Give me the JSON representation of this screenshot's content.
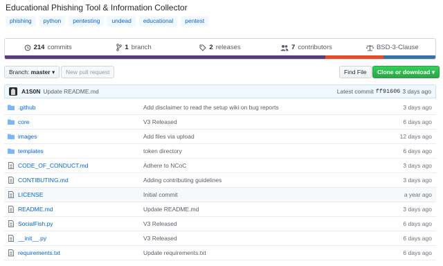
{
  "repo": {
    "description": "Educational Phishing Tool & Information Collector",
    "topics": [
      "phishing",
      "python",
      "pentesting",
      "undead",
      "educational",
      "pentest"
    ]
  },
  "summary": {
    "commits_count": "214",
    "commits_label": "commits",
    "branches_count": "1",
    "branches_label": "branch",
    "releases_count": "2",
    "releases_label": "releases",
    "contributors_count": "7",
    "contributors_label": "contributors",
    "license": "BSD-3-Clause"
  },
  "language_bar": [
    {
      "color": "#563d7c",
      "share": 0.745
    },
    {
      "color": "#e34c26",
      "share": 0.135
    },
    {
      "color": "#3572a5",
      "share": 0.12
    }
  ],
  "toolbar": {
    "branch_label": "Branch:",
    "branch_value": "master",
    "new_pr_label": "New pull request",
    "find_file_label": "Find File",
    "clone_label": "Clone or download"
  },
  "commit": {
    "author": "A1S0N",
    "message": "Update README.md",
    "latest_label": "Latest commit",
    "sha": "ff91606",
    "age": "3 days ago"
  },
  "files": [
    {
      "type": "dir",
      "name": ".github",
      "message": "Add disclaimer to read the setup wiki on bug reports",
      "age": "3 days ago"
    },
    {
      "type": "dir",
      "name": "core",
      "message": "V3 Released",
      "age": "6 days ago"
    },
    {
      "type": "dir",
      "name": "images",
      "message": "Add files via upload",
      "age": "12 days ago"
    },
    {
      "type": "dir",
      "name": "templates",
      "message": "token directory",
      "age": "6 days ago"
    },
    {
      "type": "file",
      "name": "CODE_OF_CONDUCT.md",
      "message": "Adhere to NCoC",
      "age": "3 days ago"
    },
    {
      "type": "file",
      "name": "CONTIBUTING.md",
      "message": "Adding contributing guidelines",
      "age": "3 days ago"
    },
    {
      "type": "file",
      "name": "LICENSE",
      "message": "Initial commit",
      "age": "a year ago"
    },
    {
      "type": "file",
      "name": "README.md",
      "message": "Update README.md",
      "age": "3 days ago"
    },
    {
      "type": "file",
      "name": "SocialFish.py",
      "message": "V3 Released",
      "age": "6 days ago"
    },
    {
      "type": "file",
      "name": "__init__.py",
      "message": "V3 Released",
      "age": "6 days ago"
    },
    {
      "type": "file",
      "name": "requirements.txt",
      "message": "Update requirements.txt",
      "age": "6 days ago"
    }
  ],
  "highlighted_row": 6
}
